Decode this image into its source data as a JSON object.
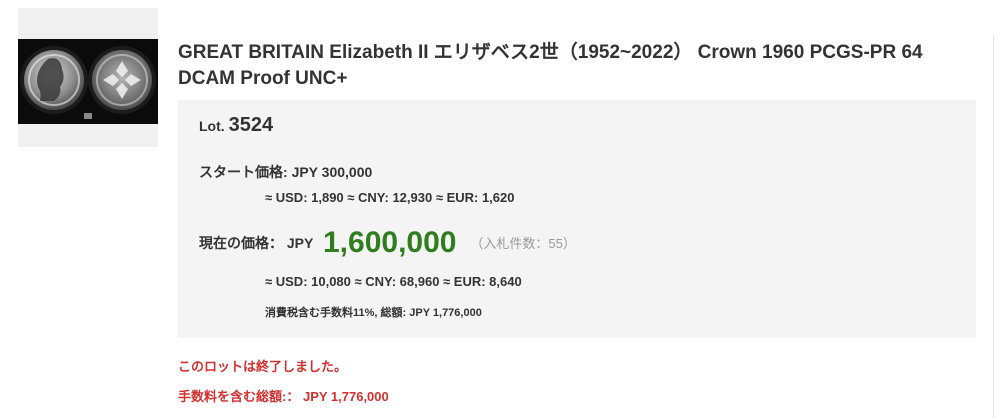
{
  "lot": {
    "title": "GREAT BRITAIN Elizabeth II エリザベス2世（1952~2022） Crown 1960 PCGS-PR 64 DCAM Proof UNC+",
    "image_alt": "Coin photo: obverse and reverse of 1960 Crown",
    "lot_label": "Lot.",
    "lot_number": "3524"
  },
  "start_price": {
    "label": "スタート価格:",
    "value": "JPY 300,000",
    "conversions": "≈ USD: 1,890 ≈ CNY: 12,930 ≈ EUR: 1,620"
  },
  "current_price": {
    "label": "現在の価格：",
    "currency": "JPY",
    "amount": "1,600,000",
    "bids": "（入札件数：55）",
    "conversions": "≈ USD: 10,080 ≈ CNY: 68,960 ≈ EUR: 8,640",
    "fee_note": "消費税含む手数料11%, 総額:  JPY 1,776,000"
  },
  "status": {
    "ended_message": "このロットは終了しました。",
    "total_label": "手数料を含む総額:：",
    "total_value": "JPY 1,776,000"
  },
  "colors": {
    "current_amount": "#2e7d1e",
    "status_text": "#d03030",
    "panel_background": "#f4f4f4"
  }
}
